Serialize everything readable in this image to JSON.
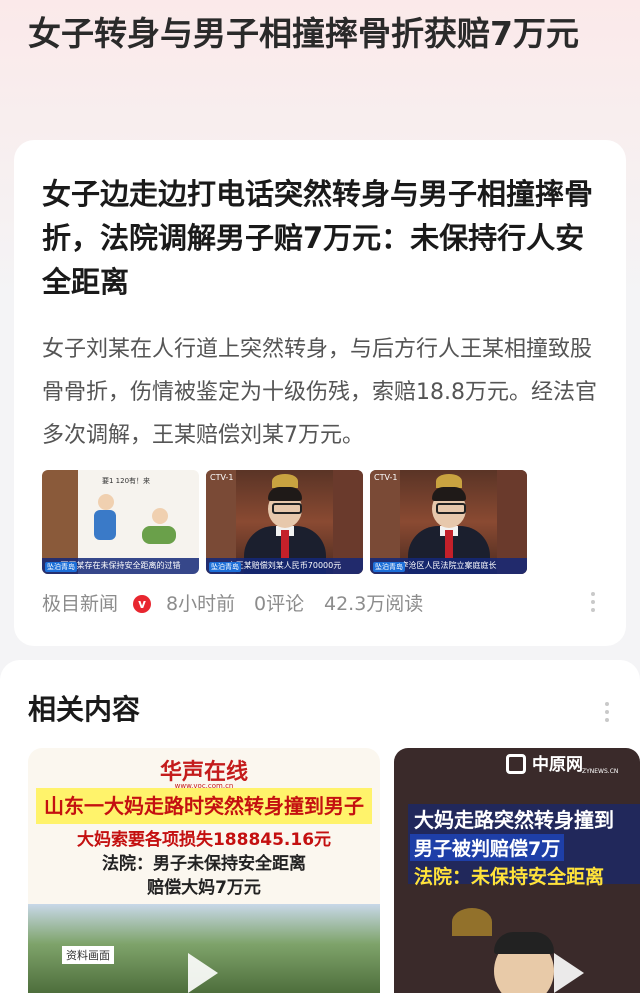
{
  "page": {
    "title": "女子转身与男子相撞摔骨折获赔7万元"
  },
  "article": {
    "title": "女子边走边打电话突然转身与男子相撞摔骨折，法院调解男子赔7万元：未保持行人安全距离",
    "summary": "女子刘某在人行道上突然转身，与后方行人王某相撞致股骨骨折，伤情被鉴定为十级伤残，索赔18.8万元。经法官多次调解，王某赔偿刘某7万元。",
    "images": [
      {
        "caption": "而王某存在未保持安全距离的过错",
        "badge": "坠泊青岛",
        "top_text": "要1 120有！来"
      },
      {
        "caption": "由王某赔偿刘某人民币70000元",
        "badge": "坠泊青岛",
        "top_text": "CTV-1"
      },
      {
        "caption": "李沧区人民法院立案庭庭长",
        "badge": "坠泊青岛",
        "top_text": "CTV-1"
      }
    ],
    "meta": {
      "source": "极目新闻",
      "verified_icon": "verified-v-icon",
      "time": "8小时前",
      "comments": "0评论",
      "reads": "42.3万阅读"
    }
  },
  "related": {
    "title": "相关内容",
    "items": [
      {
        "brand": "华声在线",
        "brand_url": "www.voc.com.cn",
        "headline": "山东一大妈走路时突然转身撞到男子",
        "lines": [
          "大妈索要各项损失188845.16元",
          "法院：男子未保持安全距离",
          "赔偿大妈7万元"
        ],
        "photo_tag": "资料画面"
      },
      {
        "brand": "中原网",
        "brand_sub": "ZYNEWS.CN",
        "lines": [
          "大妈走路突然转身撞到",
          "男子被判赔偿7万",
          "法院：未保持安全距离"
        ]
      }
    ]
  },
  "colors": {
    "accent_red": "#e8262f",
    "headline_red": "#c41010",
    "highlight_yellow": "#fff36b",
    "meta_gray": "#8c8c8c"
  }
}
